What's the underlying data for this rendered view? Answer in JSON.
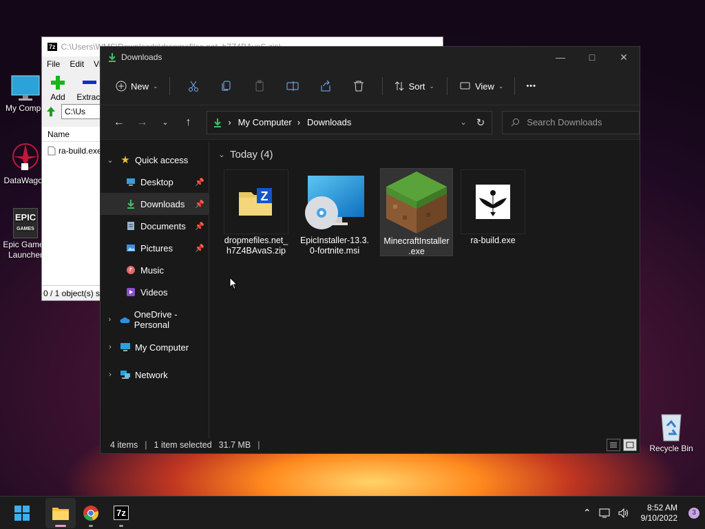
{
  "desktop": {
    "icons": [
      {
        "label": "My Compu",
        "name": "desktop-my-computer"
      },
      {
        "label": "DataWagon",
        "name": "desktop-datawagon"
      },
      {
        "label": "Epic Games Launcher",
        "name": "desktop-epic-games"
      },
      {
        "label": "Recycle Bin",
        "name": "desktop-recycle-bin"
      }
    ],
    "epic_logo": "EPIC",
    "epic_sub": "GAMES"
  },
  "sevenzip": {
    "title": "C:\\Users\\WMS\\Downloads\\dropmefiles.net_h7Z4BAvaS.zip\\",
    "menu": [
      "File",
      "Edit",
      "Vi"
    ],
    "toolbar": {
      "add": "Add",
      "extract": "Extract"
    },
    "address": "C:\\Us",
    "column_name": "Name",
    "file": "ra-build.exe",
    "status": "0 / 1 object(s) se"
  },
  "explorer": {
    "title": "Downloads",
    "command_bar": {
      "new": "New",
      "sort": "Sort",
      "view": "View",
      "more": "•••"
    },
    "breadcrumb": [
      "My Computer",
      "Downloads"
    ],
    "search_placeholder": "Search Downloads",
    "nav": {
      "quick_access": "Quick access",
      "items": [
        {
          "label": "Desktop",
          "pinned": true
        },
        {
          "label": "Downloads",
          "pinned": true,
          "selected": true
        },
        {
          "label": "Documents",
          "pinned": true
        },
        {
          "label": "Pictures",
          "pinned": true
        },
        {
          "label": "Music",
          "pinned": false
        },
        {
          "label": "Videos",
          "pinned": false
        }
      ],
      "onedrive": "OneDrive - Personal",
      "my_computer": "My Computer",
      "network": "Network"
    },
    "group": "Today (4)",
    "files": [
      {
        "name": "dropmefiles.net_h7Z4BAvaS.zip",
        "line1": "dropmefiles.net_",
        "line2": "h7Z4BAvaS.zip",
        "icon": "zip-folder-icon"
      },
      {
        "name": "EpicInstaller-13.3.0-fortnite.msi",
        "line1": "EpicInstaller-13.3.",
        "line2": "0-fortnite.msi",
        "icon": "msi-installer-icon"
      },
      {
        "name": "MinecraftInstaller.exe",
        "line1": "MinecraftInstaller",
        "line2": ".exe",
        "icon": "minecraft-grass-block-icon",
        "selected": true
      },
      {
        "name": "ra-build.exe",
        "line1": "ra-build.exe",
        "line2": "",
        "icon": "winged-emblem-icon"
      }
    ],
    "status": {
      "items": "4 items",
      "selected": "1 item selected",
      "size": "31.7 MB"
    }
  },
  "taskbar": {
    "time": "8:52 AM",
    "date": "9/10/2022",
    "notifications": "3",
    "sevenzip_label": "7z"
  }
}
